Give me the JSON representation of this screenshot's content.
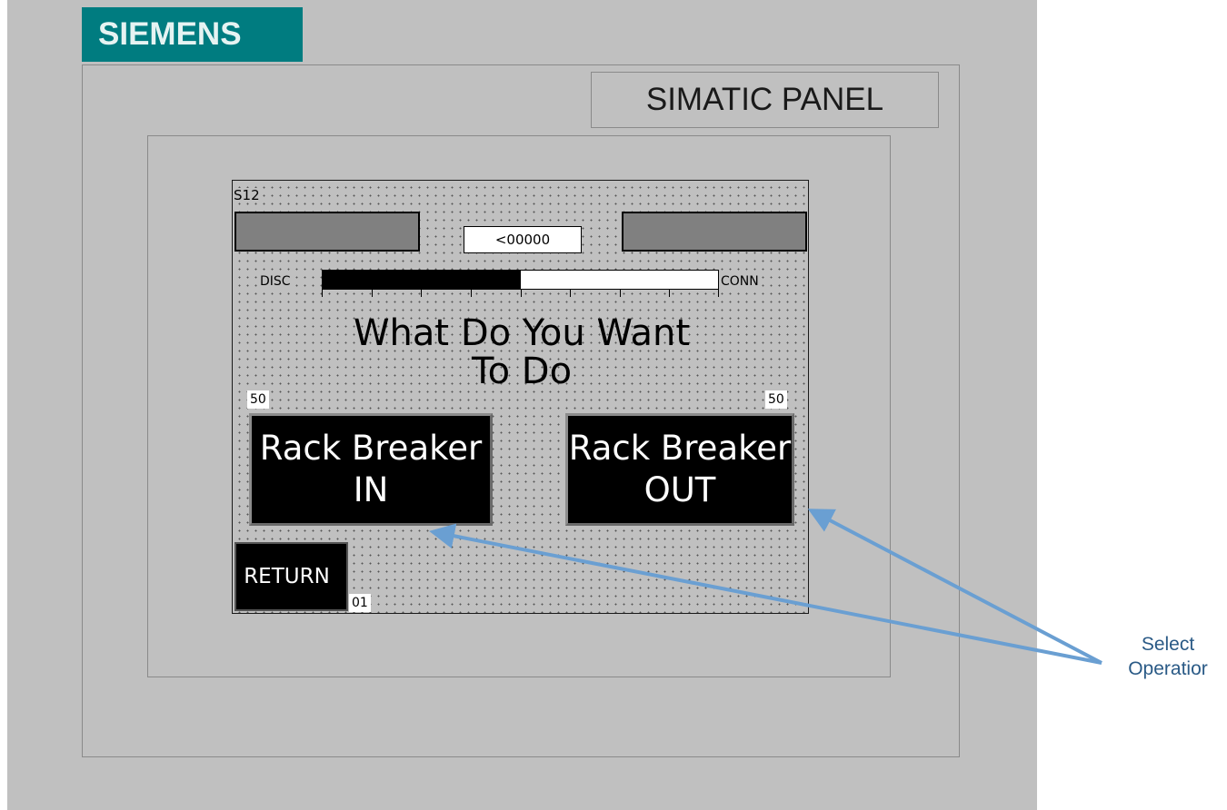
{
  "brand": {
    "logo_text": "SIEMENS",
    "color": "#007c80"
  },
  "panel": {
    "label": "SIMATIC PANEL"
  },
  "screen": {
    "screen_number": "S12",
    "value_display": "<00000",
    "position_bar": {
      "left_label": "DISC",
      "right_label": "CONN",
      "fill_fraction": 0.5
    },
    "prompt": [
      "What Do You Want",
      "To Do"
    ],
    "buttons": {
      "rack_in": {
        "count": "50",
        "line1": "Rack Breaker",
        "line2": "IN"
      },
      "rack_out": {
        "count": "50",
        "line1": "Rack Breaker",
        "line2": "OUT"
      },
      "return": {
        "label": "RETURN",
        "number": "01"
      }
    }
  },
  "callout": {
    "lines": [
      "Select",
      "Operatior"
    ],
    "color": "#6a9fd2"
  }
}
